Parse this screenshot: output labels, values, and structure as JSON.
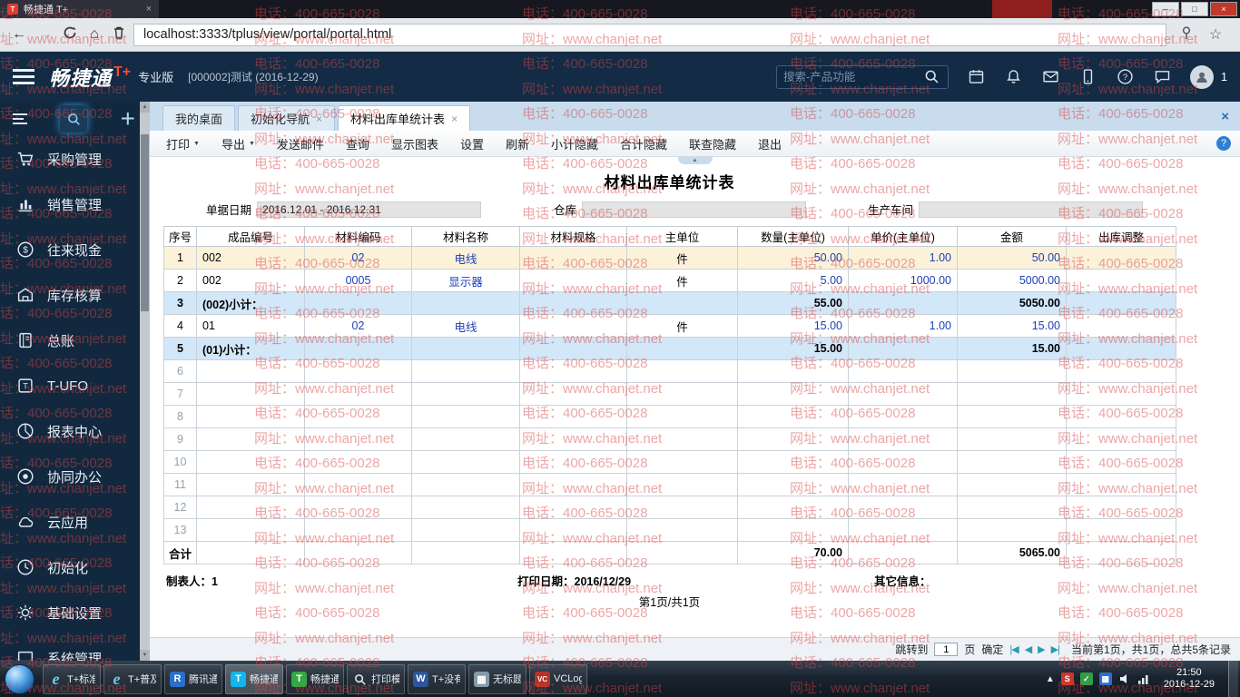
{
  "watermark": {
    "phone": "电话：400-665-0028",
    "site": "网址：www.chanjet.net"
  },
  "browser": {
    "tab": {
      "title": "畅捷通 T+",
      "close": "×"
    },
    "url": "localhost:3333/tplus/view/portal/portal.html",
    "window": {
      "minimize": "─",
      "maximize": "□",
      "close": "×"
    }
  },
  "header": {
    "brand": "畅捷通",
    "brand_plus": "T+",
    "edition": "专业版",
    "account": "[000002]测试",
    "date": "(2016-12-29)",
    "search_placeholder": "搜索-产品功能",
    "badge": "1"
  },
  "sidebar": {
    "items": [
      {
        "label": "采购管理",
        "icon": "cart-icon"
      },
      {
        "label": "销售管理",
        "icon": "chart-icon"
      },
      {
        "label": "往来现金",
        "icon": "money-icon"
      },
      {
        "label": "库存核算",
        "icon": "warehouse-icon"
      },
      {
        "label": "总账",
        "icon": "ledger-icon"
      },
      {
        "label": "T-UFO",
        "icon": "tufo-icon"
      },
      {
        "label": "报表中心",
        "icon": "report-icon"
      },
      {
        "label": "协同办公",
        "icon": "office-icon"
      },
      {
        "label": "云应用",
        "icon": "cloud-icon"
      },
      {
        "label": "初始化",
        "icon": "init-icon"
      },
      {
        "label": "基础设置",
        "icon": "settings-icon"
      },
      {
        "label": "系统管理",
        "icon": "system-icon"
      }
    ]
  },
  "tabs": [
    {
      "label": "我的桌面",
      "closable": false,
      "active": false
    },
    {
      "label": "初始化导航",
      "closable": true,
      "active": false
    },
    {
      "label": "材料出库单统计表",
      "closable": true,
      "active": true
    }
  ],
  "toolbar": {
    "items": [
      {
        "label": "打印",
        "dropdown": true
      },
      {
        "label": "导出",
        "dropdown": true
      },
      {
        "label": "发送邮件"
      },
      {
        "label": "查询"
      },
      {
        "label": "显示图表"
      },
      {
        "label": "设置"
      },
      {
        "label": "刷新"
      },
      {
        "label": "小计隐藏"
      },
      {
        "label": "合计隐藏"
      },
      {
        "label": "联查隐藏"
      },
      {
        "label": "退出"
      }
    ]
  },
  "report": {
    "title": "材料出库单统计表",
    "filters": [
      {
        "label": "单据日期",
        "value": "2016.12.01 - 2016.12.31"
      },
      {
        "label": "仓库",
        "value": ""
      },
      {
        "label": "生产车间",
        "value": ""
      }
    ],
    "columns": [
      "序号",
      "成品编号",
      "材料编码",
      "材料名称",
      "材料规格",
      "主单位",
      "数量(主单位)",
      "单价(主单位)",
      "金额",
      "出库调整"
    ],
    "rows": [
      {
        "seq": "1",
        "type": "highlight",
        "cells": [
          "002",
          "02",
          "电线",
          "",
          "件",
          "50.00",
          "1.00",
          "50.00",
          ""
        ]
      },
      {
        "seq": "2",
        "type": "normal",
        "cells": [
          "002",
          "0005",
          "显示器",
          "",
          "件",
          "5.00",
          "1000.00",
          "5000.00",
          ""
        ]
      },
      {
        "seq": "3",
        "type": "subtotal",
        "cells": [
          "(002)小计：",
          "",
          "",
          "",
          "",
          "55.00",
          "",
          "5050.00",
          ""
        ]
      },
      {
        "seq": "4",
        "type": "normal",
        "cells": [
          "01",
          "02",
          "电线",
          "",
          "件",
          "15.00",
          "1.00",
          "15.00",
          ""
        ]
      },
      {
        "seq": "5",
        "type": "subtotal",
        "cells": [
          "(01)小计：",
          "",
          "",
          "",
          "",
          "15.00",
          "",
          "15.00",
          ""
        ]
      },
      {
        "seq": "6",
        "type": "empty",
        "cells": [
          "",
          "",
          "",
          "",
          "",
          "",
          "",
          "",
          ""
        ]
      },
      {
        "seq": "7",
        "type": "empty",
        "cells": [
          "",
          "",
          "",
          "",
          "",
          "",
          "",
          "",
          ""
        ]
      },
      {
        "seq": "8",
        "type": "empty",
        "cells": [
          "",
          "",
          "",
          "",
          "",
          "",
          "",
          "",
          ""
        ]
      },
      {
        "seq": "9",
        "type": "empty",
        "cells": [
          "",
          "",
          "",
          "",
          "",
          "",
          "",
          "",
          ""
        ]
      },
      {
        "seq": "10",
        "type": "empty",
        "cells": [
          "",
          "",
          "",
          "",
          "",
          "",
          "",
          "",
          ""
        ]
      },
      {
        "seq": "11",
        "type": "empty",
        "cells": [
          "",
          "",
          "",
          "",
          "",
          "",
          "",
          "",
          ""
        ]
      },
      {
        "seq": "12",
        "type": "empty",
        "cells": [
          "",
          "",
          "",
          "",
          "",
          "",
          "",
          "",
          ""
        ]
      },
      {
        "seq": "13",
        "type": "empty",
        "cells": [
          "",
          "",
          "",
          "",
          "",
          "",
          "",
          "",
          ""
        ]
      }
    ],
    "total": {
      "label": "合计",
      "qty": "70.00",
      "amount": "5065.00"
    },
    "footer": {
      "maker": "制表人：1",
      "print_date": "打印日期：2016/12/29",
      "other": "其它信息：",
      "page": "第1页/共1页"
    }
  },
  "pagination": {
    "jump": "跳转到",
    "page_value": "1",
    "unit": "页",
    "confirm": "确定",
    "first": "|◀",
    "prev": "◀",
    "next": "▶",
    "last": "▶|",
    "status": "当前第1页，共1页，总共5条记录"
  },
  "taskbar": {
    "items": [
      {
        "label": "T+标准...",
        "icon": "ie-icon"
      },
      {
        "label": "T+普及...",
        "icon": "ie-icon"
      },
      {
        "label": "腾讯通R...",
        "icon": "rtx-icon"
      },
      {
        "label": "畅捷通 T...",
        "icon": "chanjet-icon"
      },
      {
        "label": "畅捷通T...",
        "icon": "chanjet2-icon"
      },
      {
        "label": "打印模板...",
        "icon": "magnifier-icon"
      },
      {
        "label": "T+没有...",
        "icon": "word-icon"
      },
      {
        "label": "无标题 - ...",
        "icon": "image-icon"
      },
      {
        "label": "VCLogC...",
        "icon": "vc-icon"
      }
    ],
    "clock": {
      "time": "21:50",
      "date": "2016-12-29"
    }
  }
}
